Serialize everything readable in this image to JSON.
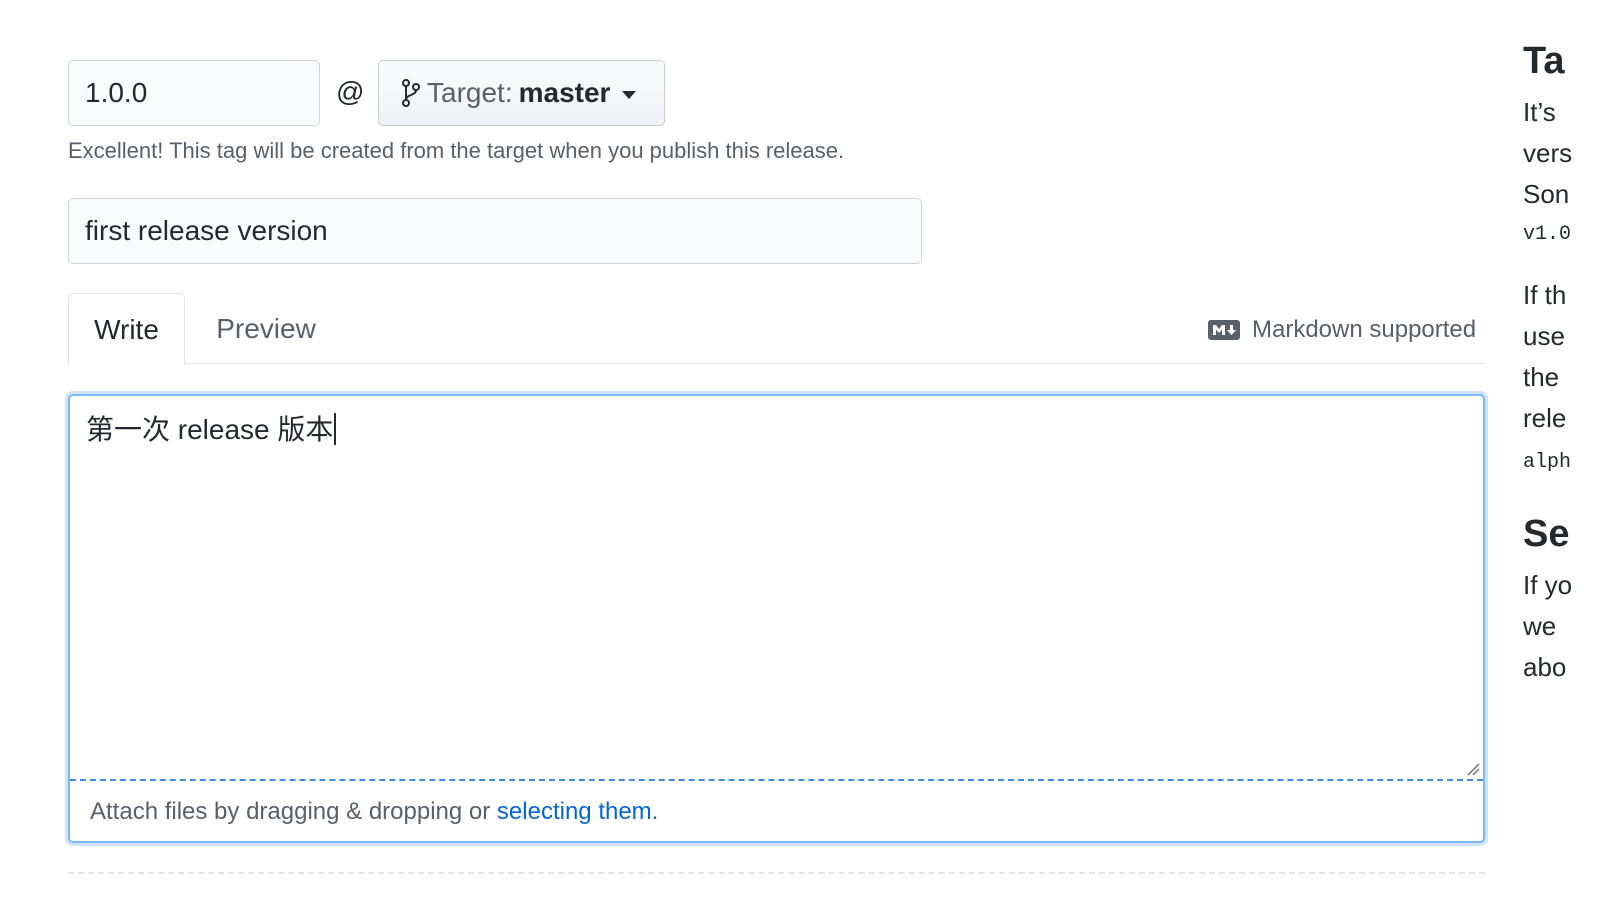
{
  "release_form": {
    "tag_version": "1.0.0",
    "at_sign": "@",
    "target": {
      "prefix": "Target:",
      "branch": "master"
    },
    "tag_hint": "Excellent! This tag will be created from the target when you publish this release.",
    "release_title": "first release version",
    "tabs": [
      "Write",
      "Preview"
    ],
    "markdown_note": "Markdown supported",
    "description_text": "第一次 release 版本",
    "attach": {
      "text": "Attach files by dragging & dropping or ",
      "link": "selecting them",
      "suffix": "."
    }
  },
  "sidebar": {
    "heading1": "Ta",
    "lines1": [
      "It’s",
      "vers",
      "Son"
    ],
    "code1": "v1.0",
    "lines2": [
      "If th",
      "use",
      "the",
      "rele"
    ],
    "code2": "alph",
    "heading2": "Se",
    "lines3": [
      "If yo",
      "we",
      "abo"
    ]
  },
  "colors": {
    "accent": "#0366d6",
    "focus_border": "#79b8ff",
    "muted_text": "#586069"
  }
}
